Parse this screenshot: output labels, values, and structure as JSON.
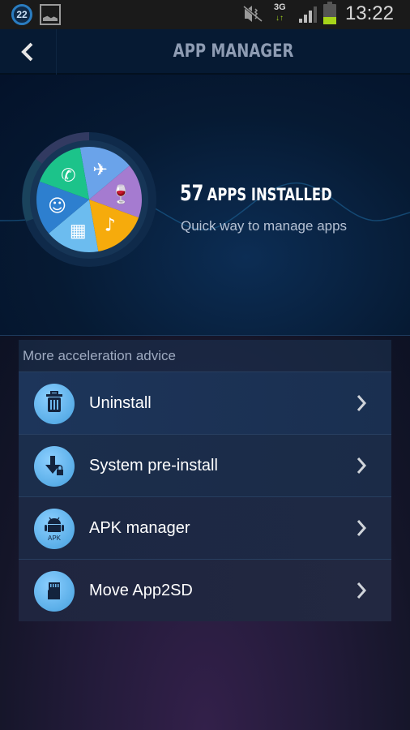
{
  "status_bar": {
    "notification_badge": "22",
    "network_type": "3G",
    "time": "13:22",
    "battery_level": 0.35,
    "signal_bars": 3,
    "icons": [
      "notification-count-icon",
      "gallery-icon",
      "mute-vibrate-icon",
      "3g-data-icon",
      "signal-icon",
      "battery-icon"
    ]
  },
  "header": {
    "title": "APP MANAGER",
    "back_icon": "chevron-left-icon"
  },
  "hero": {
    "count": "57",
    "count_label": "APPS INSTALLED",
    "subtitle": "Quick way to manage apps",
    "categories": [
      {
        "name": "travel",
        "icon": "airplane-icon",
        "color": "#6aa3ea"
      },
      {
        "name": "food-drink",
        "icon": "wine-glass-icon",
        "color": "#a57bd0"
      },
      {
        "name": "music",
        "icon": "music-note-icon",
        "color": "#f6ab0c"
      },
      {
        "name": "video",
        "icon": "film-icon",
        "color": "#6cbcef"
      },
      {
        "name": "social",
        "icon": "chat-face-icon",
        "color": "#2d7fcf"
      },
      {
        "name": "communication",
        "icon": "phone-icon",
        "color": "#1cc38a"
      }
    ]
  },
  "advice": {
    "header": "More acceleration advice",
    "items": [
      {
        "label": "Uninstall",
        "icon": "trash-icon"
      },
      {
        "label": "System pre-install",
        "icon": "download-lock-icon"
      },
      {
        "label": "APK manager",
        "icon": "android-apk-icon",
        "icon_text": "APK"
      },
      {
        "label": "Move App2SD",
        "icon": "sd-card-icon"
      }
    ]
  }
}
